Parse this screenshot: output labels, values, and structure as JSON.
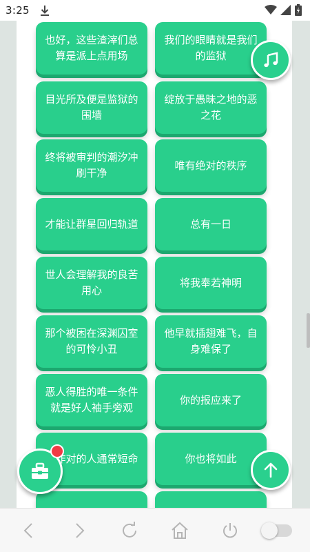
{
  "status_bar": {
    "time": "3:25",
    "icons": [
      "download-icon",
      "wifi-icon",
      "signal-icon",
      "battery-icon"
    ]
  },
  "colors": {
    "accent": "#29cf8c",
    "accent_shadow": "#1ca86f",
    "badge": "#f03a45"
  },
  "sound_buttons": [
    {
      "label": "也好，这些渣滓们总算是派上点用场"
    },
    {
      "label": "我们的眼睛就是我们的监狱"
    },
    {
      "label": "目光所及便是监狱的围墙"
    },
    {
      "label": "绽放于愚昧之地的恶之花"
    },
    {
      "label": "终将被审判的潮汐冲刷干净"
    },
    {
      "label": "唯有绝对的秩序"
    },
    {
      "label": "才能让群星回归轨道"
    },
    {
      "label": "总有一日"
    },
    {
      "label": "世人会理解我的良苦用心"
    },
    {
      "label": "将我奉若神明"
    },
    {
      "label": "那个被困在深渊囚室的可怜小丑"
    },
    {
      "label": "他早就插翅难飞，自身难保了"
    },
    {
      "label": "恶人得胜的唯一条件就是好人袖手旁观"
    },
    {
      "label": "你的报应来了"
    },
    {
      "label": "序作对的人通常短命"
    },
    {
      "label": "你也将如此"
    },
    {
      "label": ""
    },
    {
      "label": ""
    }
  ],
  "floating_buttons": {
    "music": "music-note-icon",
    "scroll_top": "arrow-up-icon",
    "toolbox": "toolbox-icon"
  },
  "navbar": {
    "items": [
      "back-icon",
      "forward-icon",
      "refresh-icon",
      "home-icon",
      "power-icon",
      "toggle-switch"
    ],
    "toggle_on": false
  }
}
